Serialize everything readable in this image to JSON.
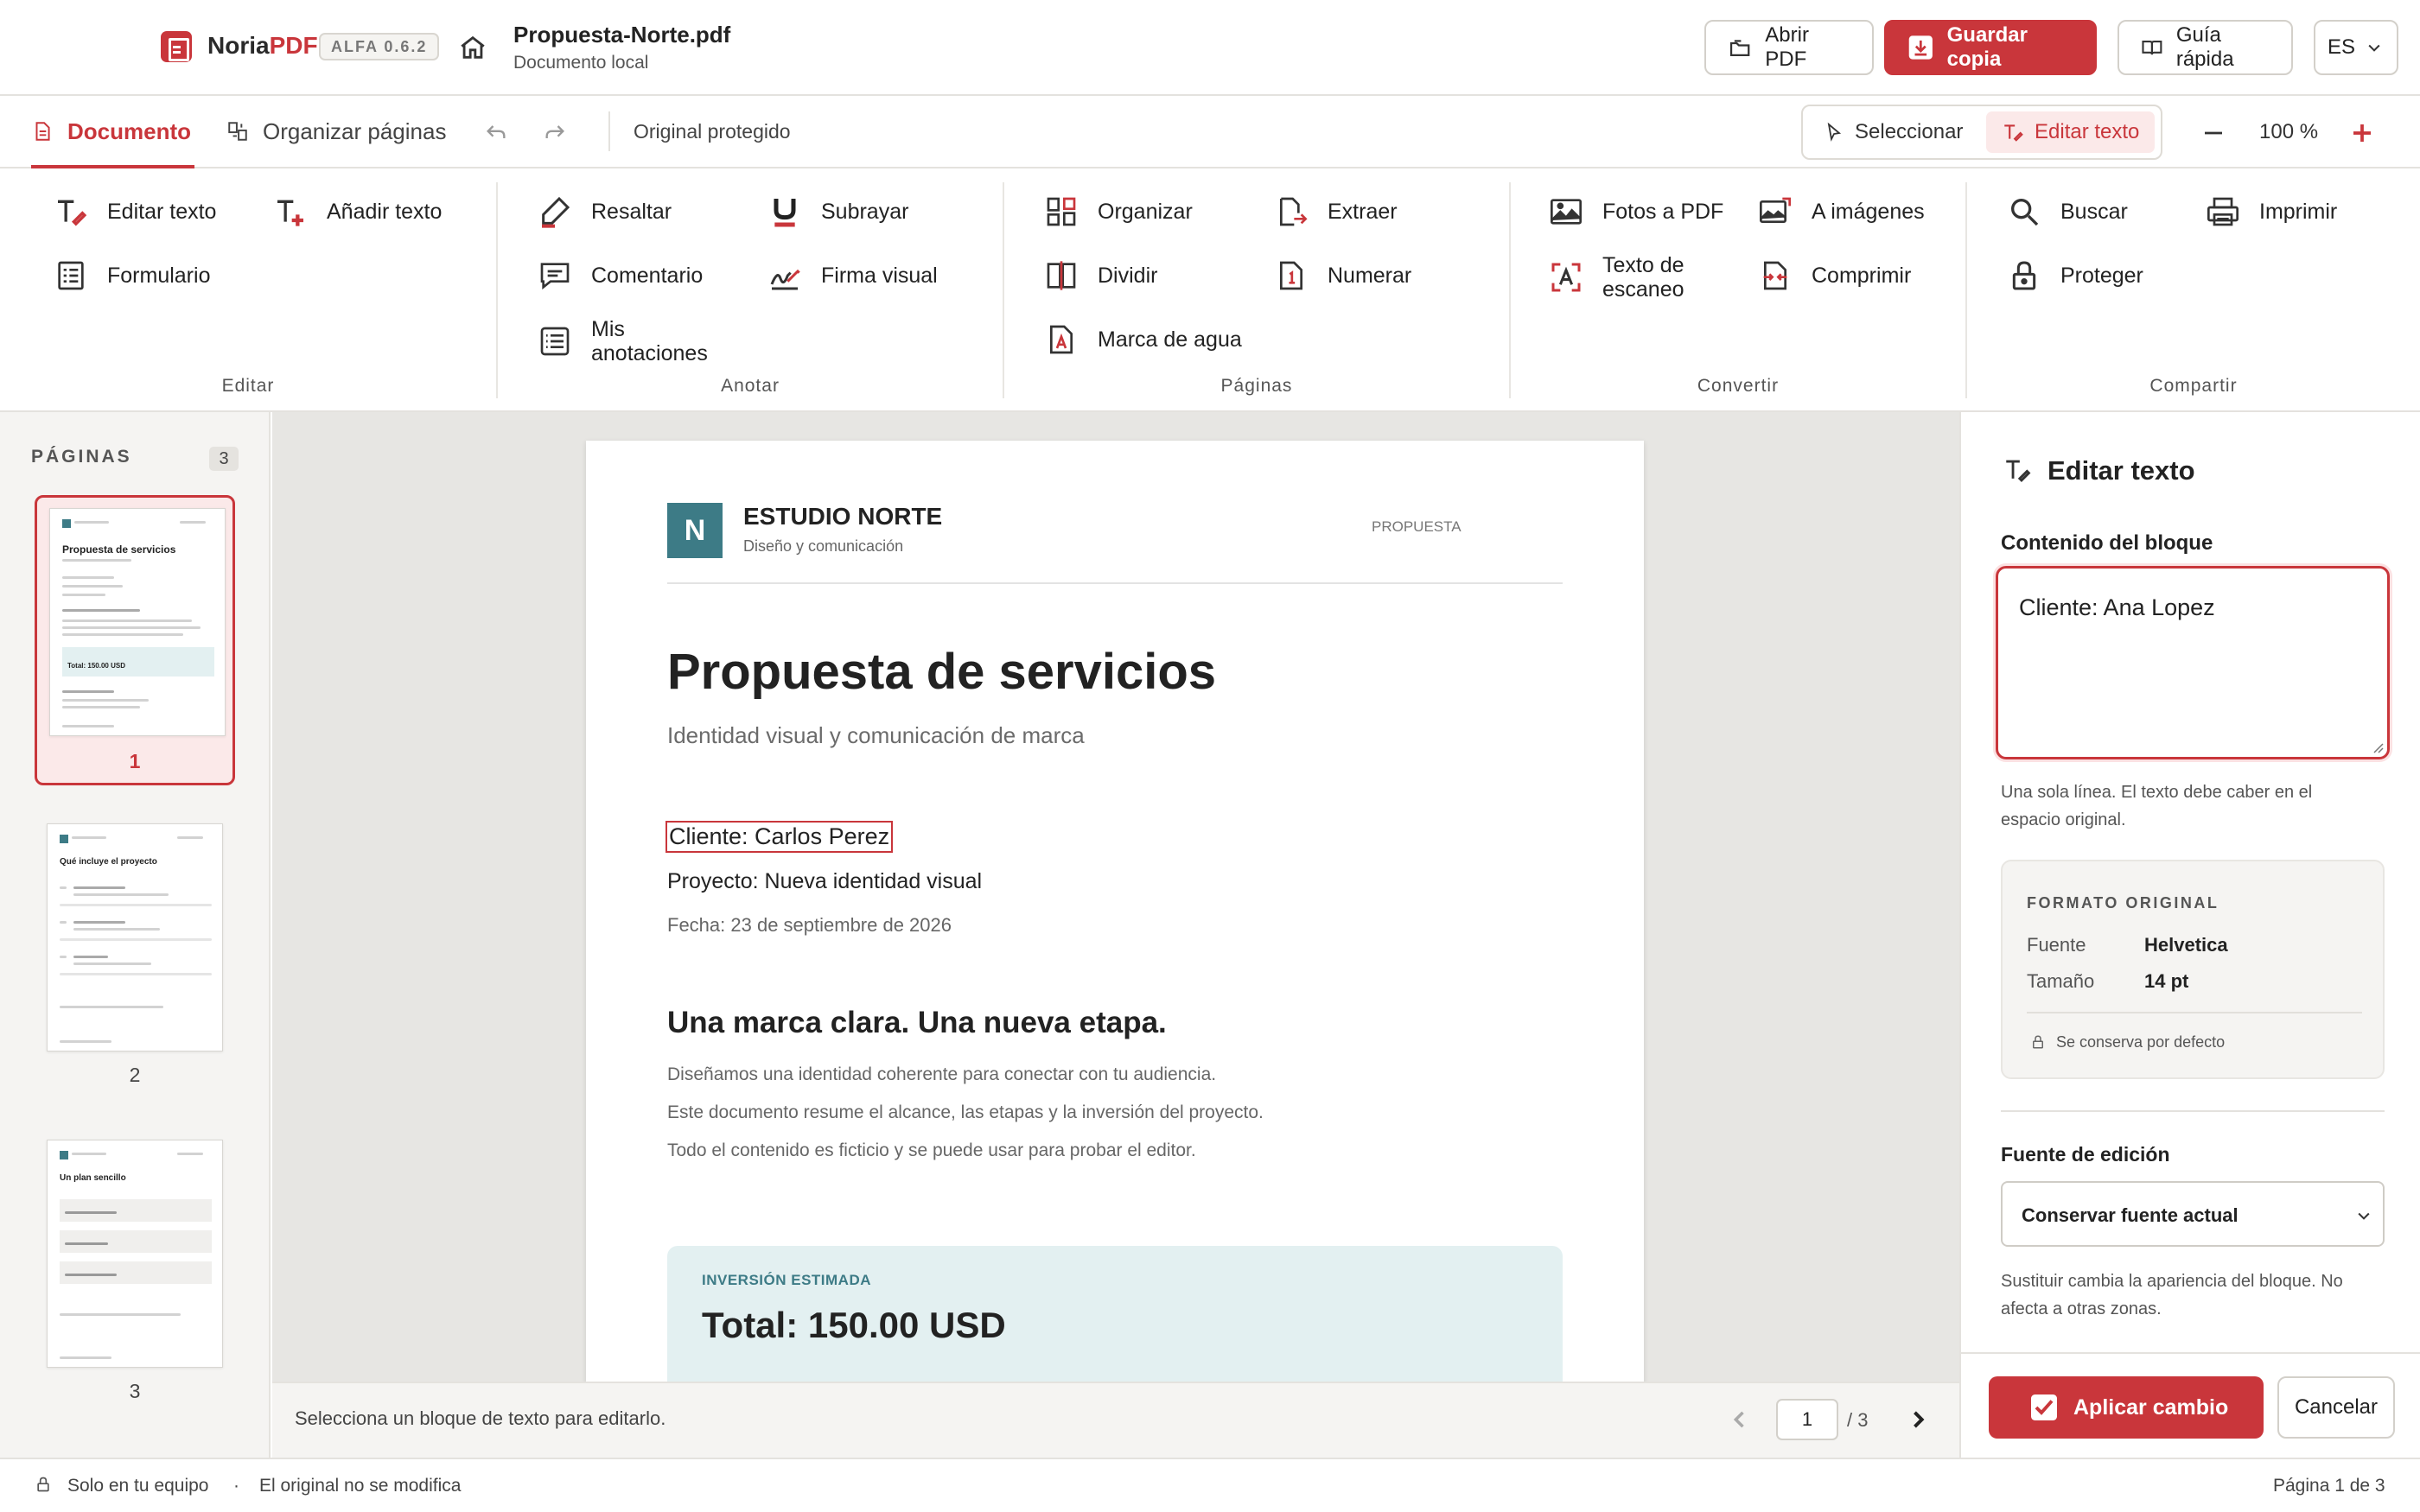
{
  "header": {
    "brand_name": "Noria",
    "brand_suffix": "PDF",
    "version": "ALFA 0.6.2",
    "doc_title": "Propuesta-Norte.pdf",
    "doc_subtitle": "Documento local",
    "open_pdf": "Abrir PDF",
    "save_copy": "Guardar copia",
    "quick_guide": "Guía rápida",
    "language": "ES"
  },
  "tabs": {
    "document": "Documento",
    "organize": "Organizar páginas",
    "status": "Original protegido",
    "select": "Seleccionar",
    "edit_text": "Editar texto",
    "zoom": "100 %"
  },
  "ribbon": {
    "edit": {
      "label": "Editar",
      "edit_text": "Editar texto",
      "add_text": "Añadir texto",
      "form": "Formulario"
    },
    "annotate": {
      "label": "Anotar",
      "highlight": "Resaltar",
      "underline": "Subrayar",
      "comment": "Comentario",
      "signature": "Firma visual",
      "my_annotations_1": "Mis",
      "my_annotations_2": "anotaciones"
    },
    "pages": {
      "label": "Páginas",
      "organize": "Organizar",
      "extract": "Extraer",
      "split": "Dividir",
      "number": "Numerar",
      "watermark": "Marca de agua"
    },
    "convert": {
      "label": "Convertir",
      "photos_to_pdf": "Fotos a PDF",
      "to_images": "A imágenes",
      "scan_text_1": "Texto de",
      "scan_text_2": "escaneo",
      "compress": "Comprimir"
    },
    "share": {
      "label": "Compartir",
      "search": "Buscar",
      "print": "Imprimir",
      "protect": "Proteger"
    }
  },
  "pages_panel": {
    "title": "PÁGINAS",
    "count": "3",
    "thumbs": [
      {
        "num": "1",
        "title": "Propuesta de servicios",
        "highlight": "Total: 150.00 USD"
      },
      {
        "num": "2",
        "title": "Qué incluye el proyecto"
      },
      {
        "num": "3",
        "title": "Un plan sencillo"
      }
    ]
  },
  "document": {
    "logo_letter": "N",
    "company": "ESTUDIO NORTE",
    "company_sub": "Diseño y comunicación",
    "doc_type": "PROPUESTA",
    "title": "Propuesta de servicios",
    "subtitle": "Identidad visual y comunicación de marca",
    "client": "Cliente: Carlos Perez",
    "project": "Proyecto: Nueva identidad visual",
    "date": "Fecha: 23 de septiembre de 2026",
    "heading2": "Una marca clara. Una nueva etapa.",
    "para1": "Diseñamos una identidad coherente para conectar con tu audiencia.",
    "para2": "Este documento resume el alcance, las etapas y la inversión del proyecto.",
    "para3": "Todo el contenido es ficticio y se puede usar para probar el editor.",
    "investment_label": "INVERSIÓN ESTIMADA",
    "total": "Total: 150.00 USD"
  },
  "status_bar": {
    "hint": "Selecciona un bloque de texto para editarlo.",
    "page_input": "1",
    "page_total": "/ 3"
  },
  "edit_panel": {
    "title": "Editar texto",
    "content_label": "Contenido del bloque",
    "content_value": "Cliente: Ana Lopez",
    "help_1": "Una sola línea. El texto debe caber en el",
    "help_2": "espacio original.",
    "format_title": "FORMATO ORIGINAL",
    "font_label": "Fuente",
    "font_value": "Helvetica",
    "size_label": "Tamaño",
    "size_value": "14 pt",
    "preserved": "Se conserva por defecto",
    "edit_font_label": "Fuente de edición",
    "edit_font_value": "Conservar fuente actual",
    "substitute_1": "Sustituir cambia la apariencia del bloque. No",
    "substitute_2": "afecta a otras zonas.",
    "apply": "Aplicar cambio",
    "cancel": "Cancelar"
  },
  "footer": {
    "local": "Solo en tu equipo",
    "separator": "·",
    "original": "El original no se modifica",
    "page_info": "Página 1 de 3"
  },
  "colors": {
    "accent": "#c9363b",
    "teal": "#3d7b86"
  }
}
